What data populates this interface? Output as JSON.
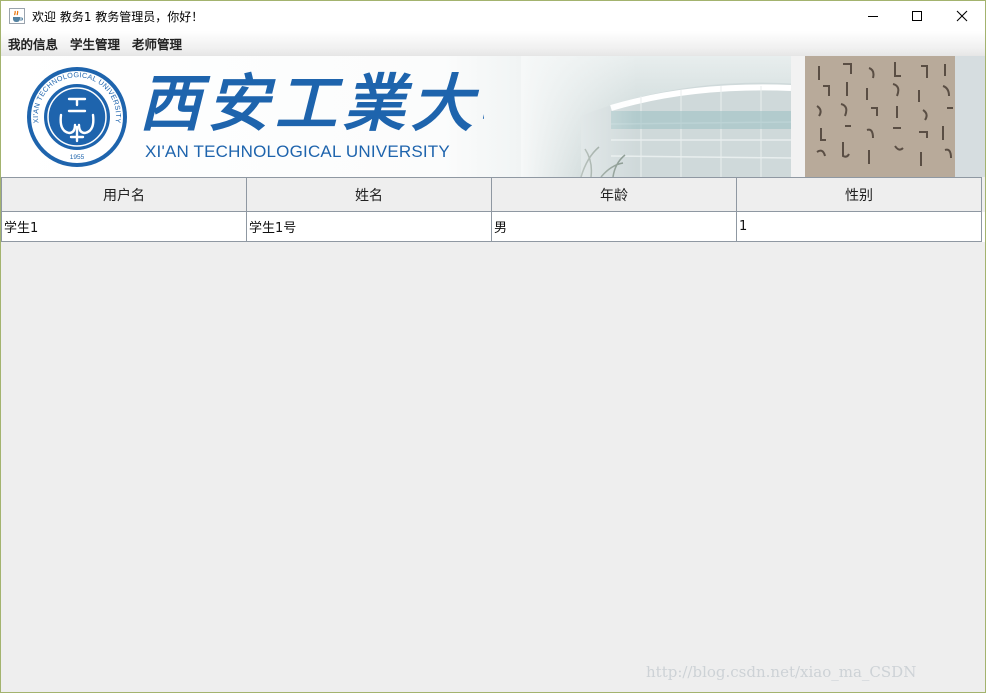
{
  "window": {
    "title": "欢迎 教务1 教务管理员，你好！",
    "app_icon": "java-cup-icon",
    "controls": {
      "minimize_icon": "minimize-icon",
      "maximize_icon": "maximize-icon",
      "close_icon": "close-icon"
    }
  },
  "menu": {
    "items": [
      {
        "label": "我的信息"
      },
      {
        "label": "学生管理"
      },
      {
        "label": "老师管理"
      }
    ]
  },
  "banner": {
    "chinese_name": "西安工業大學",
    "english_name": "XI'AN TECHNOLOGICAL UNIVERSITY",
    "seal_text": "XI'AN TECHNOLOGICAL UNIVERSITY",
    "seal_year": "1955",
    "brand_color": "#1e64ad"
  },
  "table": {
    "columns": [
      "用户名",
      "姓名",
      "年龄",
      "性别"
    ],
    "rows": [
      [
        "学生1",
        "学生1号",
        "男",
        "1"
      ]
    ]
  },
  "watermark": "http://blog.csdn.net/xiao_ma_CSDN"
}
